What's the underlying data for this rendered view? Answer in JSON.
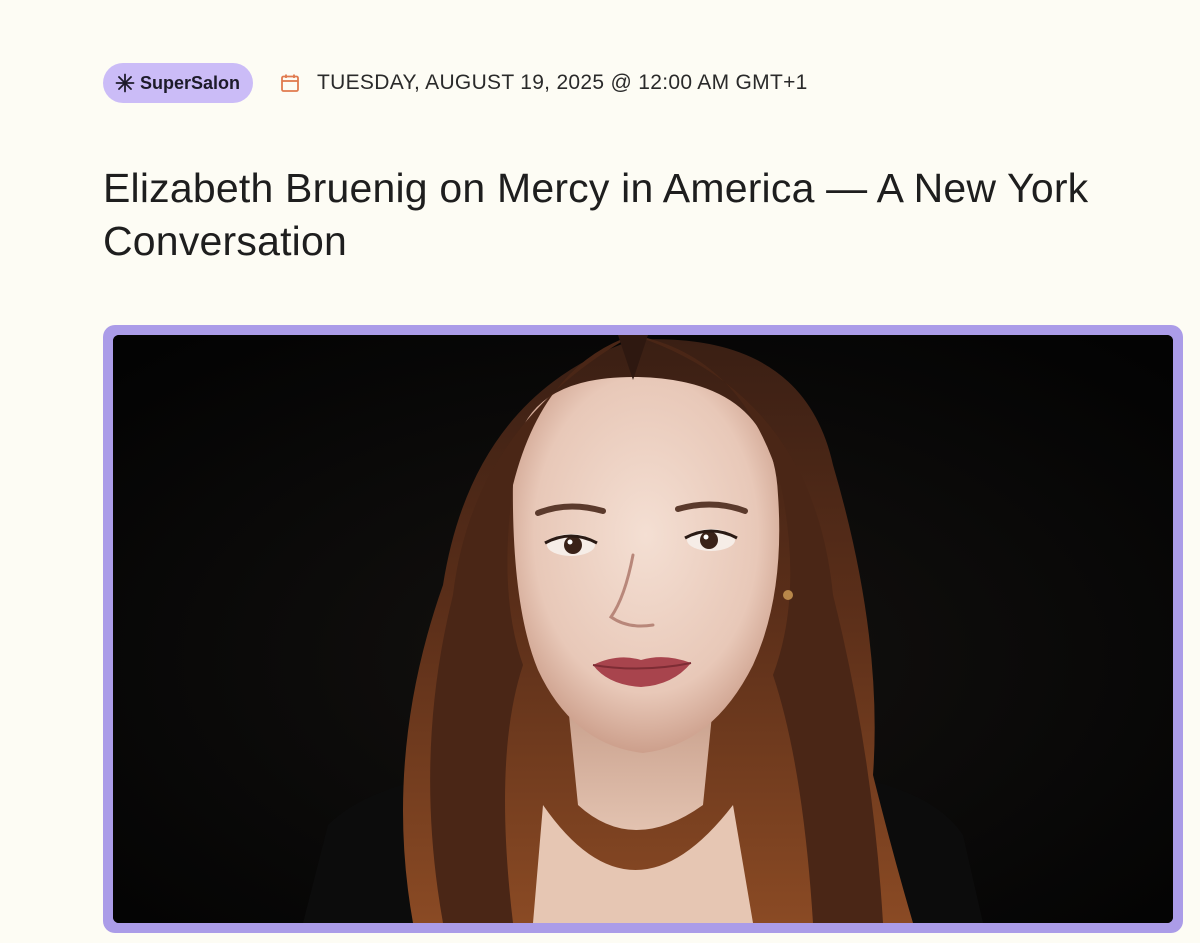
{
  "event": {
    "tag": {
      "label": "SuperSalon",
      "icon": "asterisk-spark-icon",
      "color": "#cbbcf7"
    },
    "date_icon": "calendar-icon",
    "date_text": "TUESDAY, AUGUST 19, 2025 @ 12:00 AM GMT+1",
    "title": "Elizabeth Bruenig on Mercy in America —  A New York Conversation"
  },
  "hero_image": {
    "subject": "portrait-photo",
    "frame_color": "#ab9ce8"
  },
  "colors": {
    "background": "#fdfcf4",
    "accent_purple": "#ab9ce8",
    "calendar_orange": "#e07a4e"
  }
}
